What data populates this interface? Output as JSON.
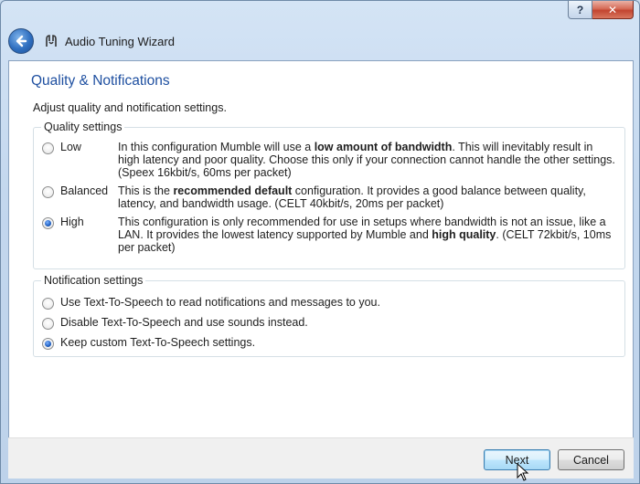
{
  "window": {
    "title": "Audio Tuning Wizard",
    "help_label": "?",
    "close_label": "✕"
  },
  "page": {
    "title": "Quality & Notifications",
    "subtitle": "Adjust quality and notification settings."
  },
  "quality": {
    "group_label": "Quality settings",
    "options": [
      {
        "label": "Low",
        "checked": false,
        "desc_pre": "In this configuration Mumble will use a ",
        "desc_bold": "low amount of bandwidth",
        "desc_post": ". This will inevitably result in high latency and poor quality. Choose this only if your connection cannot handle the other settings. (Speex 16kbit/s, 60ms per packet)"
      },
      {
        "label": "Balanced",
        "checked": false,
        "desc_pre": "This is the ",
        "desc_bold": "recommended default",
        "desc_post": " configuration. It provides a good balance between quality, latency, and bandwidth usage. (CELT 40kbit/s, 20ms per packet)"
      },
      {
        "label": "High",
        "checked": true,
        "desc_pre": "This configuration is only recommended for use in setups where bandwidth is not an issue, like a LAN. It provides the lowest latency supported by Mumble and ",
        "desc_bold": "high quality",
        "desc_post": ". (CELT 72kbit/s, 10ms per packet)"
      }
    ]
  },
  "notifications": {
    "group_label": "Notification settings",
    "options": [
      {
        "label": "Use Text-To-Speech to read notifications and messages to you.",
        "checked": false
      },
      {
        "label": "Disable Text-To-Speech and use sounds instead.",
        "checked": false
      },
      {
        "label": "Keep custom Text-To-Speech settings.",
        "checked": true
      }
    ]
  },
  "buttons": {
    "next": "Next",
    "cancel": "Cancel"
  }
}
